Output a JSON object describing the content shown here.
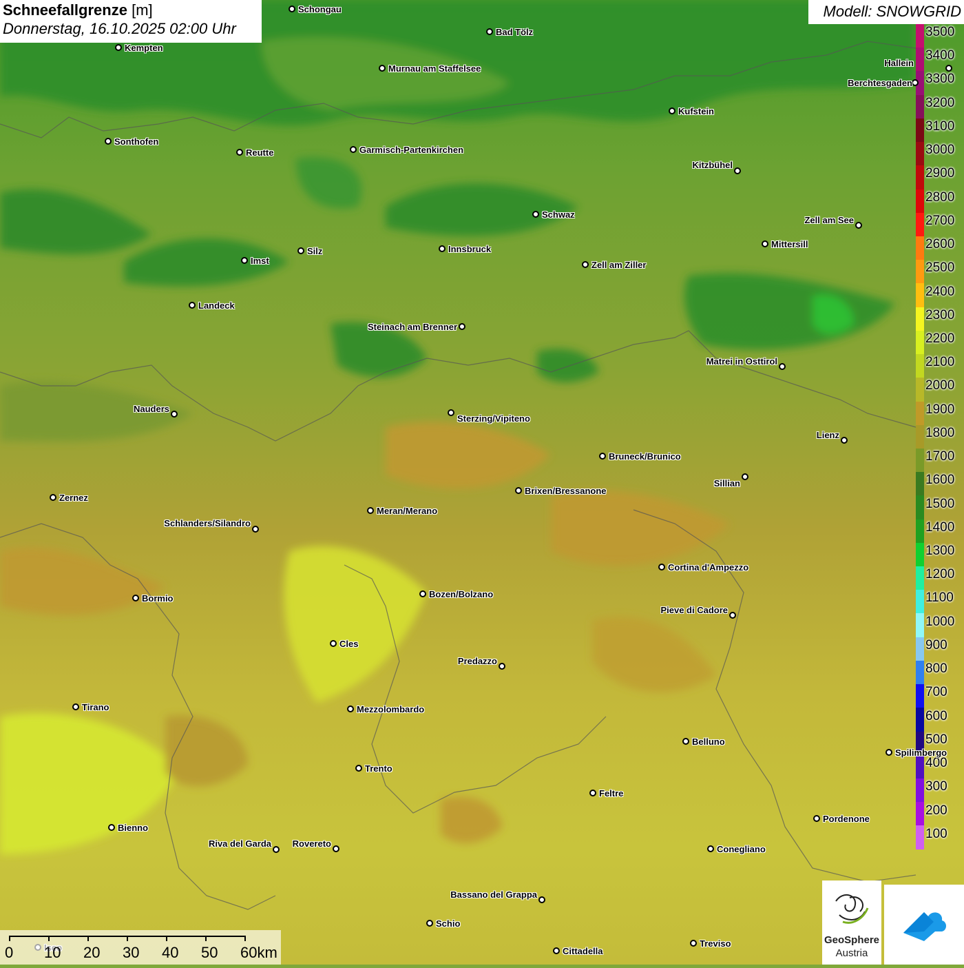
{
  "title": {
    "main": "Schneefallgrenze",
    "unit": "[m]",
    "datetime": "Donnerstag, 16.10.2025 02:00 Uhr"
  },
  "model": "Modell: SNOWGRID",
  "legend": {
    "labels": [
      "3500",
      "3400",
      "3300",
      "3200",
      "3100",
      "3000",
      "2900",
      "2800",
      "2700",
      "2600",
      "2500",
      "2400",
      "2300",
      "2200",
      "2100",
      "2000",
      "1900",
      "1800",
      "1700",
      "1600",
      "1500",
      "1400",
      "1300",
      "1200",
      "1100",
      "1000",
      "900",
      "800",
      "700",
      "600",
      "500",
      "400",
      "300",
      "200",
      "100"
    ],
    "colors": [
      "#c4106e",
      "#b00e72",
      "#991075",
      "#86105a",
      "#7a0a14",
      "#9a0c10",
      "#c00a0a",
      "#dd0808",
      "#ff1a10",
      "#ff7a10",
      "#ff9a10",
      "#ffbe10",
      "#f5f520",
      "#d8f020",
      "#c2d820",
      "#b8b828",
      "#c09a28",
      "#a89a28",
      "#7a9a28",
      "#3a7a20",
      "#2a8a20",
      "#20a020",
      "#10d030",
      "#20f0a0",
      "#40f0e0",
      "#90f8f8",
      "#88c8f0",
      "#3080f0",
      "#1010f0",
      "#0808a0",
      "#200880",
      "#5010c0",
      "#8010e0",
      "#a810e0",
      "#d060f0"
    ],
    "colors_note": "snowline color ramp"
  },
  "cities": [
    {
      "name": "Schongau"
    },
    {
      "name": "Bad Tölz"
    },
    {
      "name": "Kempten"
    },
    {
      "name": "Murnau am Staffelsee"
    },
    {
      "name": "Kufstein"
    },
    {
      "name": "Berchtesgaden"
    },
    {
      "name": "Hallein"
    },
    {
      "name": "Sonthofen"
    },
    {
      "name": "Reutte"
    },
    {
      "name": "Garmisch-Partenkirchen"
    },
    {
      "name": "Kitzbühel"
    },
    {
      "name": "Schwaz"
    },
    {
      "name": "Zell am See"
    },
    {
      "name": "Innsbruck"
    },
    {
      "name": "Mittersill"
    },
    {
      "name": "Imst"
    },
    {
      "name": "Silz"
    },
    {
      "name": "Zell am Ziller"
    },
    {
      "name": "Landeck"
    },
    {
      "name": "Steinach am Brenner"
    },
    {
      "name": "Matrei in Osttirol"
    },
    {
      "name": "Nauders"
    },
    {
      "name": "Sterzing/Vipiteno"
    },
    {
      "name": "Lienz"
    },
    {
      "name": "Bruneck/Brunico"
    },
    {
      "name": "Sillian"
    },
    {
      "name": "Zernez"
    },
    {
      "name": "Brixen/Bressanone"
    },
    {
      "name": "Meran/Merano"
    },
    {
      "name": "Schlanders/Silandro"
    },
    {
      "name": "Cortina d'Ampezzo"
    },
    {
      "name": "Bormio"
    },
    {
      "name": "Bozen/Bolzano"
    },
    {
      "name": "Pieve di Cadore"
    },
    {
      "name": "Cles"
    },
    {
      "name": "Predazzo"
    },
    {
      "name": "Tirano"
    },
    {
      "name": "Mezzolombardo"
    },
    {
      "name": "Belluno"
    },
    {
      "name": "Spilimbergo"
    },
    {
      "name": "Trento"
    },
    {
      "name": "Feltre"
    },
    {
      "name": "Pordenone"
    },
    {
      "name": "Bienno"
    },
    {
      "name": "Riva del Garda"
    },
    {
      "name": "Rovereto"
    },
    {
      "name": "Conegliano"
    },
    {
      "name": "Bassano del Grappa"
    },
    {
      "name": "Schio"
    },
    {
      "name": "Treviso"
    },
    {
      "name": "Cittadella"
    },
    {
      "name": "Iseo"
    }
  ],
  "scale": {
    "labels": [
      "0",
      "10",
      "20",
      "30",
      "40",
      "50",
      "60km"
    ]
  },
  "logos": {
    "geosphere_line1": "GeoSphere",
    "geosphere_line2": "Austria"
  }
}
